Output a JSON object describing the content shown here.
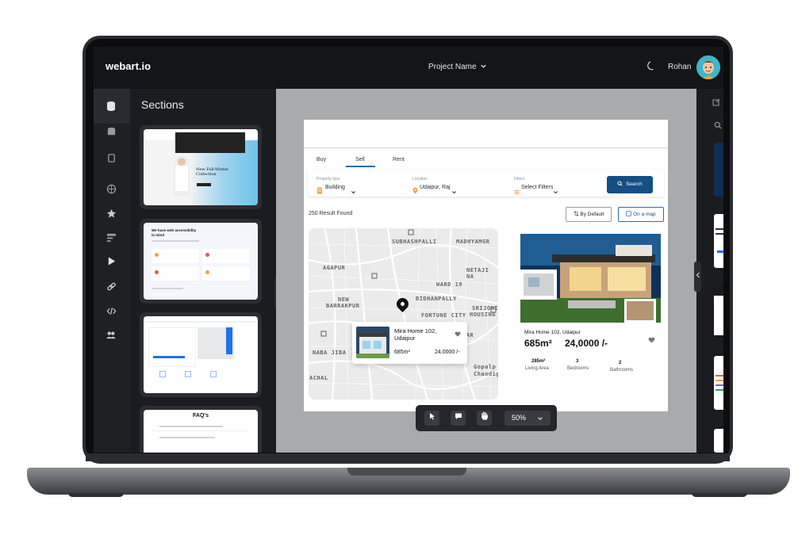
{
  "app": {
    "logo": "webart.io",
    "project_name": "Project Name",
    "user_name": "Rohan"
  },
  "sections_panel": {
    "title": "Sections",
    "cards": [
      {
        "heading": "New Fall-Winter Collection"
      },
      {
        "heading": "We have web accessibility in mind"
      },
      {
        "heading": ""
      },
      {
        "heading": "FAQ's"
      }
    ]
  },
  "canvas_page": {
    "tabs": [
      "Buy",
      "Sell",
      "Rent"
    ],
    "active_tab": "Sell",
    "filters": {
      "property_type_label": "Property type",
      "property_type_value": "Building",
      "location_label": "Location",
      "location_value": "Udaipur, Raj",
      "filters_label": "Filters",
      "filters_value": "Select Filters",
      "search_label": "Search"
    },
    "results_text": "250 Result Found",
    "sort_label": "By Default",
    "map_toggle_label": "On a map",
    "map_labels": [
      "SUBHASHPALLI",
      "MADHYAMGR",
      "AGAPUR",
      "NETAJI NA",
      "WARD 19",
      "NEW",
      "BARRAKPUR",
      "BIDHANPALLY",
      "SRIJONI",
      "FORTUNE CITY",
      "HOUSING",
      "GAR",
      "NABA JIBA",
      "Gopalp",
      "Chandig",
      "ACHAL"
    ],
    "map_popup": {
      "title": "Mira Home 102, Udaipur",
      "area": "685m²",
      "price": "24,0000 /-"
    },
    "listing": {
      "title": "Mira Home 102, Udaipur",
      "area": "685m²",
      "price": "24,0000 /-",
      "stats": [
        {
          "value": "285m²",
          "label": "Living Area"
        },
        {
          "value": "3",
          "label": "Bedrooms"
        },
        {
          "value": "2",
          "label": "Bathrooms"
        }
      ]
    }
  },
  "toolbar": {
    "zoom": "50%"
  },
  "colors": {
    "accent": "#144e85",
    "dark_bg": "#141518",
    "canvas_bg": "#a9aaac"
  }
}
